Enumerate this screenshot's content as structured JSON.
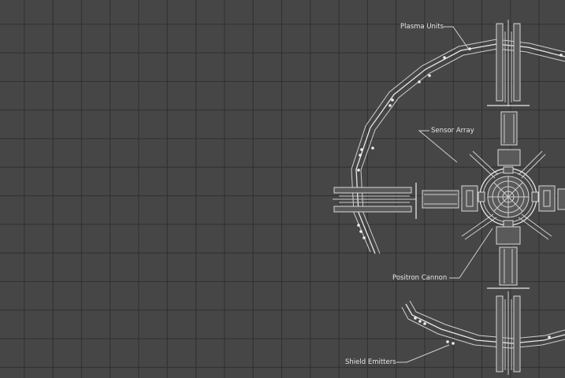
{
  "labels": {
    "plasma_units": "Plasma Units",
    "sensor_array": "Sensor Array",
    "positron_cannon": "Positron Cannon",
    "shield_emitters": "Shield Emitters"
  },
  "colors": {
    "background": "#464646",
    "grid_lines": "#2f2f2f",
    "linework": "#d8d8d8"
  }
}
